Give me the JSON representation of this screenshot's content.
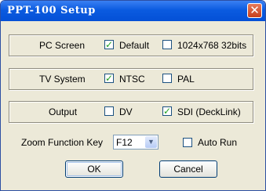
{
  "window": {
    "title": "PPT-100  Setup"
  },
  "titlebar": {
    "close_glyph": "✕",
    "close_icon": "close-icon"
  },
  "groups": {
    "pc_screen": {
      "label": "PC Screen",
      "options": [
        {
          "label": "Default",
          "checked": true
        },
        {
          "label": "1024x768 32bits",
          "checked": false
        }
      ]
    },
    "tv_system": {
      "label": "TV System",
      "options": [
        {
          "label": "NTSC",
          "checked": true
        },
        {
          "label": "PAL",
          "checked": false
        }
      ]
    },
    "output": {
      "label": "Output",
      "options": [
        {
          "label": "DV",
          "checked": false
        },
        {
          "label": "SDI (DeckLink)",
          "checked": true
        }
      ]
    }
  },
  "zoom": {
    "label": "Zoom Function Key",
    "value": "F12"
  },
  "auto_run": {
    "label": "Auto Run",
    "checked": false
  },
  "buttons": {
    "ok": "OK",
    "cancel": "Cancel"
  },
  "colors": {
    "title_bar": "#0B5BE0",
    "dialog_bg": "#ECE9D8",
    "check_mark": "#21A121",
    "close_button": "#C73F1B"
  }
}
